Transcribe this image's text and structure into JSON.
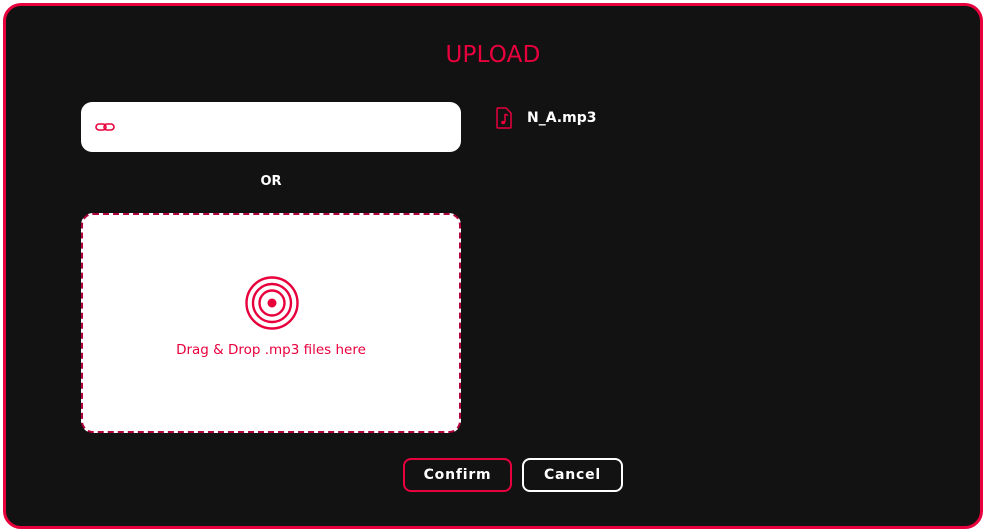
{
  "dialog": {
    "title": "UPLOAD"
  },
  "url_input": {
    "icon": "link-icon",
    "value": "",
    "placeholder": ""
  },
  "divider_text": "OR",
  "dropzone": {
    "icon": "disc-icon",
    "text": "Drag & Drop .mp3 files here"
  },
  "files": [
    {
      "icon": "music-file-icon",
      "name": "N_A.mp3"
    }
  ],
  "actions": {
    "confirm_label": "Confirm",
    "cancel_label": "Cancel"
  },
  "colors": {
    "accent": "#e8003d",
    "background": "#121212",
    "surface": "#ffffff",
    "text": "#ffffff"
  }
}
